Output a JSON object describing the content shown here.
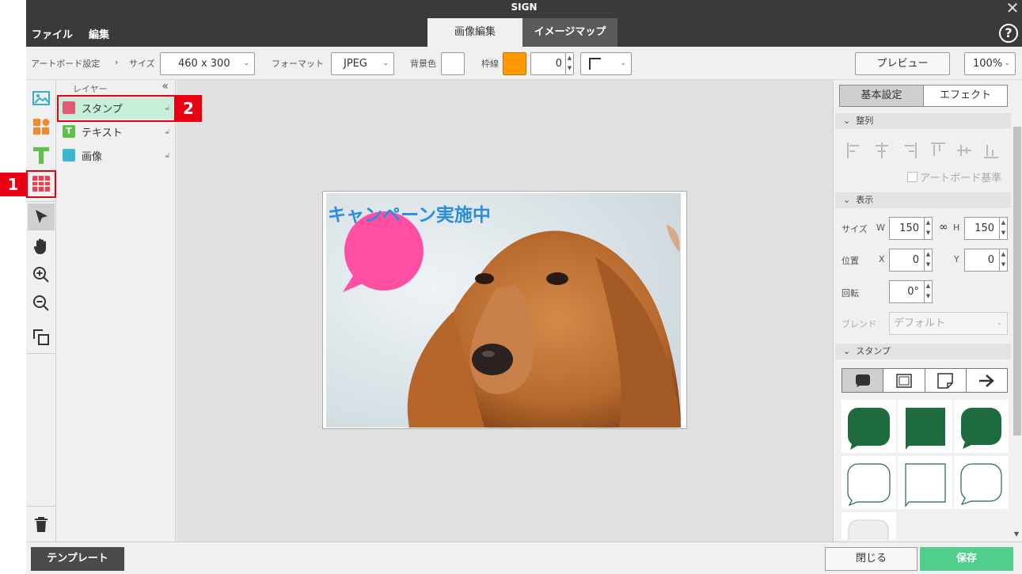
{
  "app": {
    "title": "SIGN"
  },
  "menu": [
    "ファイル",
    "編集"
  ],
  "tabs": {
    "image_edit": "画像編集",
    "image_map": "イメージマップ"
  },
  "toolbar": {
    "breadcrumb_artboard": "アートボード設定",
    "breadcrumb_sep": "›",
    "size_label": "サイズ",
    "size_value": "460 x 300",
    "format_label": "フォーマット",
    "format_value": "JPEG",
    "bg_label": "背景色",
    "bg_color": "#ffffff",
    "border_label": "枠線",
    "border_color": "#ff9900",
    "border_width": "0",
    "preview_label": "プレビュー",
    "zoom_value": "100%"
  },
  "layers": {
    "header": "レイヤー",
    "collapse": "«",
    "items": [
      {
        "name": "スタンプ",
        "icon_color": "#e35a73",
        "selected": true
      },
      {
        "name": "テキスト",
        "icon_color": "#5cc24a",
        "selected": false
      },
      {
        "name": "画像",
        "icon_color": "#39b8cf",
        "selected": false
      }
    ]
  },
  "callouts": {
    "one": "1",
    "two": "2"
  },
  "canvas": {
    "banner_text": "キャンペーン実施中",
    "bubble_color": "#ff4fa3"
  },
  "right_panel": {
    "tab_basic": "基本設定",
    "tab_effect": "エフェクト",
    "section_align": "整列",
    "artboard_basis": "アートボード基準",
    "section_display": "表示",
    "size_label": "サイズ",
    "w_label": "W",
    "w_value": "150",
    "h_label": "H",
    "h_value": "150",
    "position_label": "位置",
    "x_label": "X",
    "x_value": "0",
    "y_label": "Y",
    "y_value": "0",
    "rotation_label": "回転",
    "rotation_value": "0°",
    "blend_label": "ブレンド",
    "blend_value": "デフォルト",
    "section_stamp": "スタンプ",
    "stamp_color": "#1e6b40"
  },
  "bottom": {
    "template_label": "テンプレート",
    "close_label": "閉じる",
    "save_label": "保存"
  }
}
